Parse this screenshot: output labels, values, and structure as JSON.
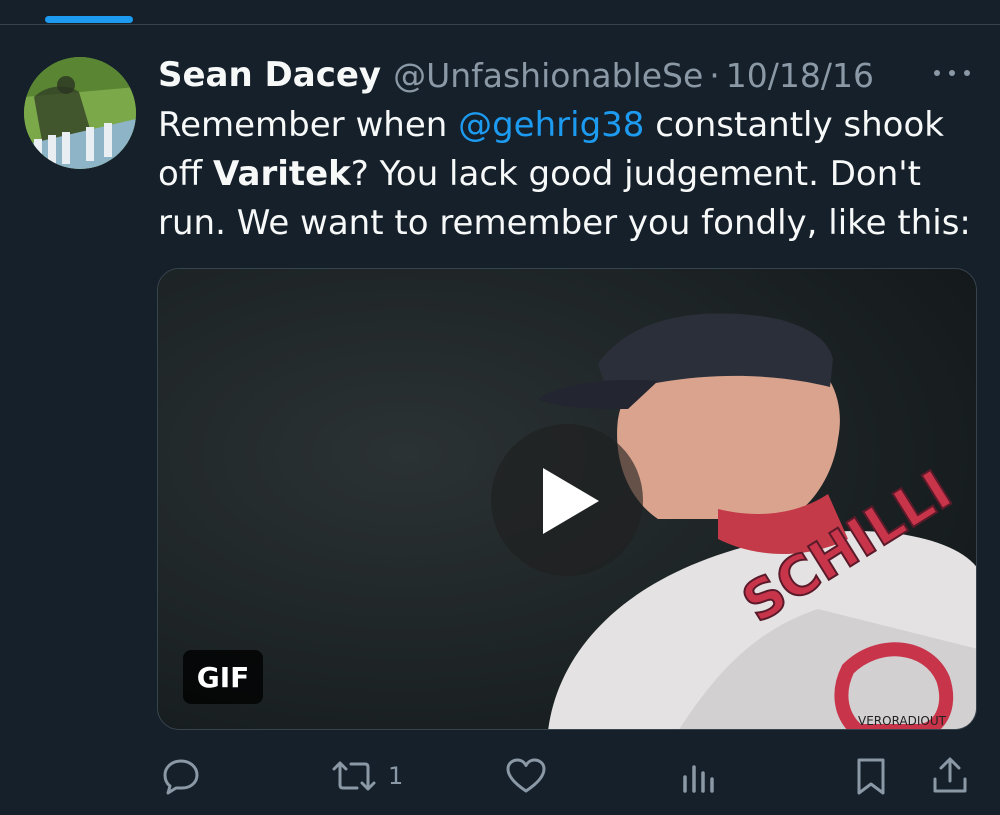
{
  "tweet": {
    "author": {
      "display_name": "Sean Dacey",
      "handle": "@UnfashionableSe",
      "separator": "·",
      "date": "10/18/16"
    },
    "text_parts": {
      "p1": "Remember when ",
      "mention": "@gehrig38",
      "p2": " constantly shook off ",
      "bold": "Varitek",
      "p3": "? You lack good judgement. Don't run. We want to remember you fondly, like this:"
    },
    "media": {
      "badge": "GIF",
      "jersey_text": "SCHILLI",
      "watermark": "VERORADIOUT"
    },
    "actions": {
      "reply_icon": "reply-icon",
      "retweet_icon": "retweet-icon",
      "retweet_count": "1",
      "like_icon": "heart-icon",
      "views_icon": "views-icon",
      "bookmark_icon": "bookmark-icon",
      "share_icon": "share-icon"
    }
  },
  "colors": {
    "background": "#15202b",
    "accent": "#1d9bf0",
    "secondary_text": "#8b98a5",
    "primary_text": "#f7f9f9"
  }
}
